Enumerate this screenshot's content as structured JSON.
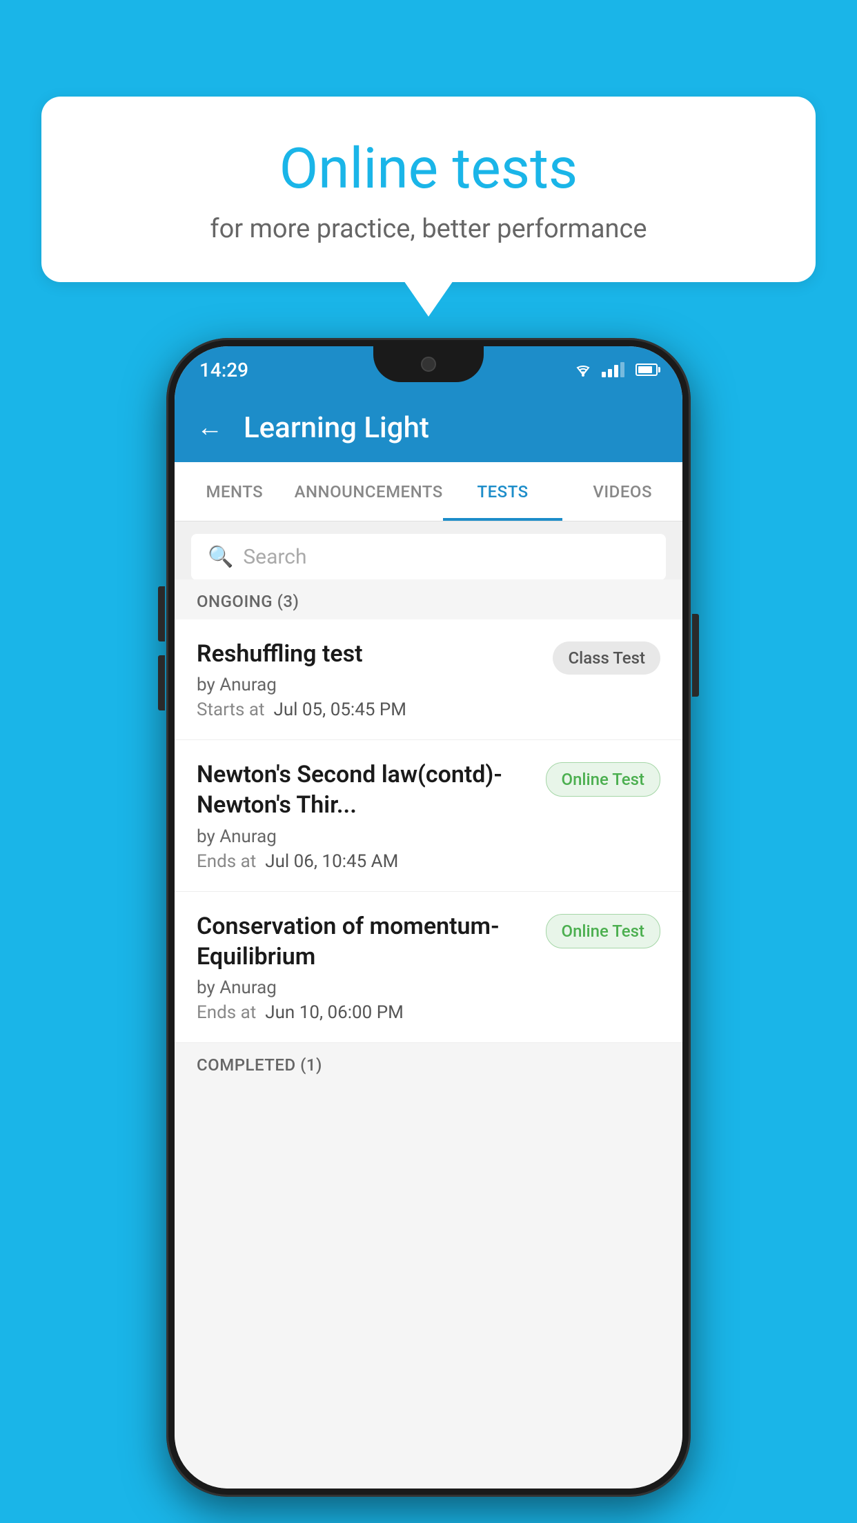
{
  "background_color": "#1ab5e8",
  "bubble": {
    "title": "Online tests",
    "subtitle": "for more practice, better performance"
  },
  "phone": {
    "status_bar": {
      "time": "14:29"
    },
    "header": {
      "title": "Learning Light",
      "back_label": "←"
    },
    "tabs": [
      {
        "id": "ments",
        "label": "MENTS",
        "active": false
      },
      {
        "id": "announcements",
        "label": "ANNOUNCEMENTS",
        "active": false
      },
      {
        "id": "tests",
        "label": "TESTS",
        "active": true
      },
      {
        "id": "videos",
        "label": "VIDEOS",
        "active": false
      }
    ],
    "search": {
      "placeholder": "Search"
    },
    "sections": [
      {
        "title": "ONGOING (3)",
        "items": [
          {
            "name": "Reshuffling test",
            "by": "by Anurag",
            "date_label": "Starts at",
            "date": "Jul 05, 05:45 PM",
            "badge": "Class Test",
            "badge_type": "class"
          },
          {
            "name": "Newton's Second law(contd)-Newton's Thir...",
            "by": "by Anurag",
            "date_label": "Ends at",
            "date": "Jul 06, 10:45 AM",
            "badge": "Online Test",
            "badge_type": "online"
          },
          {
            "name": "Conservation of momentum-Equilibrium",
            "by": "by Anurag",
            "date_label": "Ends at",
            "date": "Jun 10, 06:00 PM",
            "badge": "Online Test",
            "badge_type": "online"
          }
        ]
      },
      {
        "title": "COMPLETED (1)",
        "items": []
      }
    ]
  }
}
